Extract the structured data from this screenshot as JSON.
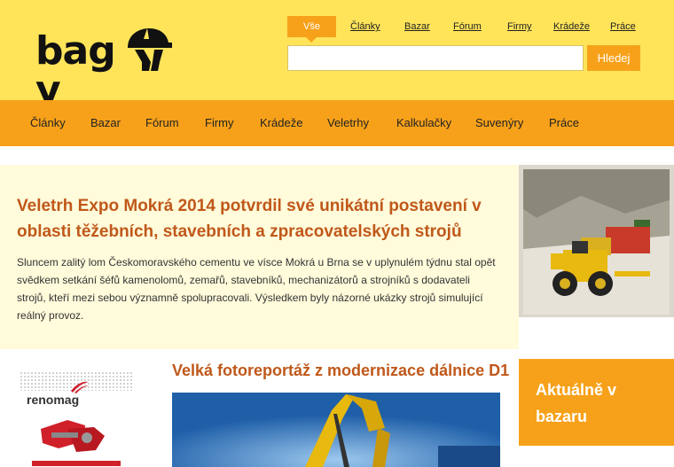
{
  "brand": {
    "logo_text": "bag y"
  },
  "search": {
    "tabs": [
      "Vše",
      "Články",
      "Bazar",
      "Fórum",
      "Firmy",
      "Krádeže",
      "Práce"
    ],
    "placeholder": "",
    "button_label": "Hledej"
  },
  "nav": {
    "items": [
      "Články",
      "Bazar",
      "Fórum",
      "Firmy",
      "Krádeže",
      "Veletrhy",
      "Kalkulačky",
      "Suvenýry",
      "Práce"
    ]
  },
  "featured": {
    "title": "Veletrh Expo Mokrá 2014 potvrdil své unikátní postavení v oblasti těžebních, stavebních a zpracovatelských strojů",
    "text": "Sluncem zalitý lom Českomoravského cementu ve vísce Mokrá u Brna se v uplynulém týdnu stal opět svědkem setkání šéfů kamenolomů, zemařů, stavebníků, mechanizátorů a strojníků s dodavateli strojů, kteří mezi sebou významně spolupracovali. Výsledkem byly názorné ukázky strojů simulující reálný provoz."
  },
  "ad": {
    "brand": "renomag"
  },
  "article2": {
    "title": "Velká fotoreportáž z modernizace dálnice D1"
  },
  "bazar_box": {
    "title": "Aktuálně v bazaru"
  },
  "colors": {
    "header_bg": "#ffe45a",
    "nav_bg": "#f7a11a",
    "title": "#c0581a",
    "featured_bg": "#fffbdb"
  }
}
